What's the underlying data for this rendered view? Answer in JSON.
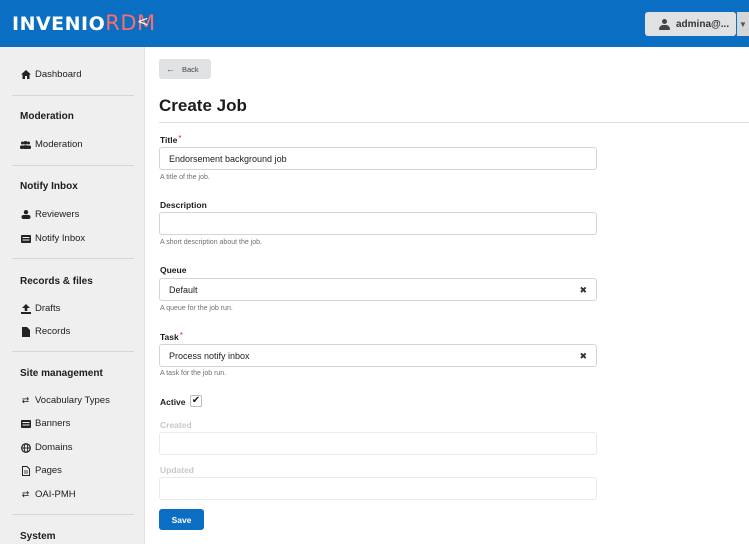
{
  "header": {
    "logo_text_white": "INVENIO",
    "logo_text_accent": "RDM",
    "collapse_glyph": "<",
    "user_label": "admina@...",
    "user_caret": "▼",
    "colors": {
      "bar": "#0a6fc2",
      "logo_accent": "#ff6d6a"
    }
  },
  "sidebar": {
    "dashboard": {
      "label": "Dashboard",
      "icon": "home-icon"
    },
    "sections": [
      {
        "title": "Moderation",
        "items": [
          {
            "label": "Moderation",
            "icon": "users-icon"
          }
        ]
      },
      {
        "title": "Notify Inbox",
        "items": [
          {
            "label": "Reviewers",
            "icon": "user-icon"
          },
          {
            "label": "Notify Inbox",
            "icon": "inbox-icon"
          }
        ]
      },
      {
        "title": "Records & files",
        "items": [
          {
            "label": "Drafts",
            "icon": "upload-icon"
          },
          {
            "label": "Records",
            "icon": "file-icon"
          }
        ]
      },
      {
        "title": "Site management",
        "items": [
          {
            "label": "Vocabulary Types",
            "icon": "exchange-icon"
          },
          {
            "label": "Banners",
            "icon": "banner-icon"
          },
          {
            "label": "Domains",
            "icon": "globe-icon"
          },
          {
            "label": "Pages",
            "icon": "page-icon"
          },
          {
            "label": "OAI-PMH",
            "icon": "exchange-icon"
          }
        ]
      },
      {
        "title": "System",
        "items": []
      }
    ]
  },
  "main": {
    "back_label": "Back",
    "page_title": "Create Job",
    "fields": {
      "title": {
        "label": "Title",
        "required": "*",
        "value": "Endorsement background job",
        "help": "A title of the job."
      },
      "description": {
        "label": "Description",
        "value": "",
        "help": "A short description about the job."
      },
      "queue": {
        "label": "Queue",
        "value": "Default",
        "clear": "✖",
        "help": "A queue for the job run."
      },
      "task": {
        "label": "Task",
        "required": "*",
        "value": "Process notify inbox",
        "clear": "✖",
        "help": "A task for the job run."
      },
      "active": {
        "label": "Active",
        "checked_glyph": "✔"
      },
      "created": {
        "label": "Created",
        "value": ""
      },
      "updated": {
        "label": "Updated",
        "value": ""
      }
    },
    "save_label": "Save"
  }
}
